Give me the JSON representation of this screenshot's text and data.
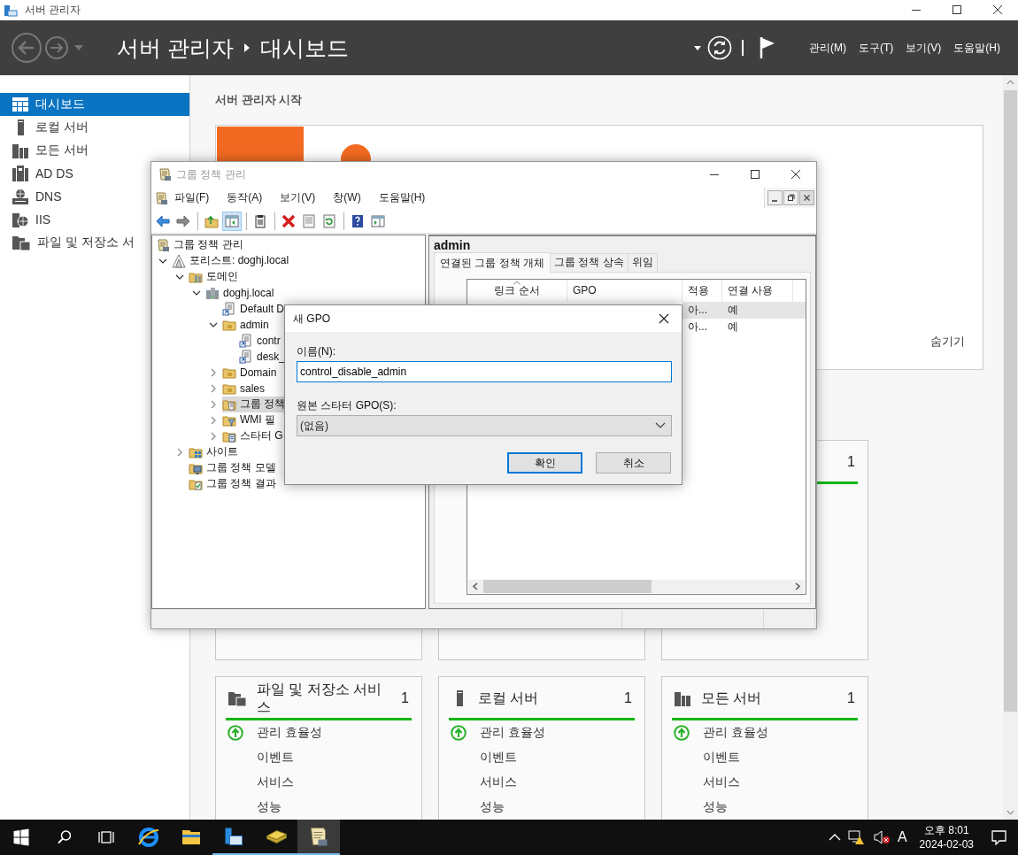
{
  "server_manager": {
    "title": "서버 관리자",
    "breadcrumb": [
      "서버 관리자",
      "대시보드"
    ],
    "menus": [
      "관리(M)",
      "도구(T)",
      "보기(V)",
      "도움말(H)"
    ],
    "sidebar": [
      {
        "label": "대시보드",
        "kind": "dashboard",
        "selected": true
      },
      {
        "label": "로컬 서버",
        "kind": "local",
        "selected": false
      },
      {
        "label": "모든 서버",
        "kind": "all",
        "selected": false
      },
      {
        "label": "AD DS",
        "kind": "adds",
        "selected": false
      },
      {
        "label": "DNS",
        "kind": "dns",
        "selected": false
      },
      {
        "label": "IIS",
        "kind": "iis",
        "selected": false
      },
      {
        "label": "파일 및 저장소 서",
        "kind": "files",
        "selected": false
      }
    ],
    "heading": "서버 관리자 시작",
    "quick_start": {
      "hide_link": "숨기기"
    },
    "tile_row_1": [
      {
        "kind": "covered"
      },
      {
        "kind": "covered"
      },
      {
        "kind": "count",
        "count": "1"
      }
    ],
    "tiles": [
      {
        "title": "파일 및 저장소 서비스",
        "kind": "files",
        "count": "1",
        "rows": [
          {
            "label": "관리 효율성",
            "kind": "status"
          },
          {
            "label": "이벤트",
            "kind": "plain"
          },
          {
            "label": "서비스",
            "kind": "plain"
          },
          {
            "label": "성능",
            "kind": "plain"
          }
        ]
      },
      {
        "title": "로컬 서버",
        "kind": "local",
        "count": "1",
        "rows": [
          {
            "label": "관리 효율성",
            "kind": "status"
          },
          {
            "label": "이벤트",
            "kind": "plain"
          },
          {
            "label": "서비스",
            "kind": "plain"
          },
          {
            "label": "성능",
            "kind": "plain"
          }
        ]
      },
      {
        "title": "모든 서버",
        "kind": "all",
        "count": "1",
        "rows": [
          {
            "label": "관리 효율성",
            "kind": "status"
          },
          {
            "label": "이벤트",
            "kind": "plain"
          },
          {
            "label": "서비스",
            "kind": "plain"
          },
          {
            "label": "성능",
            "kind": "plain"
          }
        ]
      }
    ]
  },
  "gpm_window": {
    "title": "그룹 정책 관리",
    "menus": [
      "파일(F)",
      "동작(A)",
      "보기(V)",
      "창(W)",
      "도움말(H)"
    ],
    "toolbar": [
      {
        "kind": "back",
        "pressed": false
      },
      {
        "kind": "forward",
        "pressed": false
      },
      {
        "kind": "separator"
      },
      {
        "kind": "up",
        "pressed": false
      },
      {
        "kind": "pane",
        "pressed": true
      },
      {
        "kind": "separator"
      },
      {
        "kind": "clipboard",
        "pressed": false
      },
      {
        "kind": "separator"
      },
      {
        "kind": "delete",
        "pressed": false
      },
      {
        "kind": "properties",
        "pressed": false
      },
      {
        "kind": "refresh",
        "pressed": false
      },
      {
        "kind": "separator"
      },
      {
        "kind": "help",
        "pressed": false
      },
      {
        "kind": "view",
        "pressed": false
      }
    ],
    "tree": [
      {
        "label": "그룹 정책 관리",
        "kind": "gpm",
        "selected": false,
        "children": [
          {
            "label": "포리스트: doghj.local",
            "kind": "forest",
            "expanded": true,
            "selected": false,
            "children": [
              {
                "label": "도메인",
                "kind": "domains",
                "expanded": true,
                "selected": false,
                "children": [
                  {
                    "label": "doghj.local",
                    "kind": "domain",
                    "expanded": true,
                    "selected": false,
                    "children": [
                      {
                        "label": "Default D",
                        "kind": "gpo_link",
                        "selected": false
                      },
                      {
                        "label": "admin",
                        "kind": "ou",
                        "expanded": true,
                        "selected": false,
                        "children": [
                          {
                            "label": "contr",
                            "kind": "gpo_link",
                            "selected": false
                          },
                          {
                            "label": "desk_",
                            "kind": "gpo_link",
                            "selected": false
                          }
                        ]
                      },
                      {
                        "label": "Domain",
                        "kind": "ou",
                        "expanded": false,
                        "selected": false
                      },
                      {
                        "label": "sales",
                        "kind": "ou",
                        "expanded": false,
                        "selected": false
                      },
                      {
                        "label": "그룹 정책",
                        "kind": "gpo_folder",
                        "expanded": false,
                        "selected": true
                      },
                      {
                        "label": "WMI 필",
                        "kind": "wmi",
                        "expanded": false,
                        "selected": false
                      },
                      {
                        "label": "스타터 G",
                        "kind": "starter",
                        "expanded": false,
                        "selected": false
                      }
                    ]
                  }
                ]
              },
              {
                "label": "사이트",
                "kind": "sites",
                "expanded": false,
                "selected": false
              },
              {
                "label": "그룹 정책 모델",
                "kind": "modeling",
                "selected": false
              },
              {
                "label": "그룹 정책 결과",
                "kind": "results",
                "selected": false
              }
            ]
          }
        ]
      }
    ],
    "detail": {
      "heading": "admin",
      "tabs": [
        {
          "label": "연결된 그룹 정책 개체",
          "selected": true
        },
        {
          "label": "그룹 정책 상속",
          "selected": false
        },
        {
          "label": "위임",
          "selected": false
        }
      ],
      "columns": [
        {
          "label": "링크 순서",
          "sorted": true
        },
        {
          "label": "GPO"
        },
        {
          "label": "적용"
        },
        {
          "label": "연결 사용"
        }
      ],
      "rows": [
        {
          "applied": "아...",
          "link_enabled": "예",
          "selected": true
        },
        {
          "applied": "아...",
          "link_enabled": "예",
          "selected": false
        }
      ]
    }
  },
  "new_gpo_dialog": {
    "title": "새 GPO",
    "name_label": "이름(N):",
    "name_value": "control_disable_admin",
    "starter_label": "원본 스타터 GPO(S):",
    "starter_value": "(없음)",
    "buttons": [
      {
        "label": "확인",
        "default": true
      },
      {
        "label": "취소",
        "default": false
      }
    ]
  },
  "taskbar": {
    "apps": [
      {
        "kind": "browser",
        "running": false,
        "active": false
      },
      {
        "kind": "folder",
        "running": false,
        "active": false
      },
      {
        "kind": "server",
        "running": true,
        "active": false
      },
      {
        "kind": "box",
        "running": true,
        "active": false
      },
      {
        "kind": "scroll",
        "running": true,
        "active": true
      }
    ],
    "input_indicator": "A",
    "time": "오후 8:01",
    "date": "2024-02-03"
  }
}
